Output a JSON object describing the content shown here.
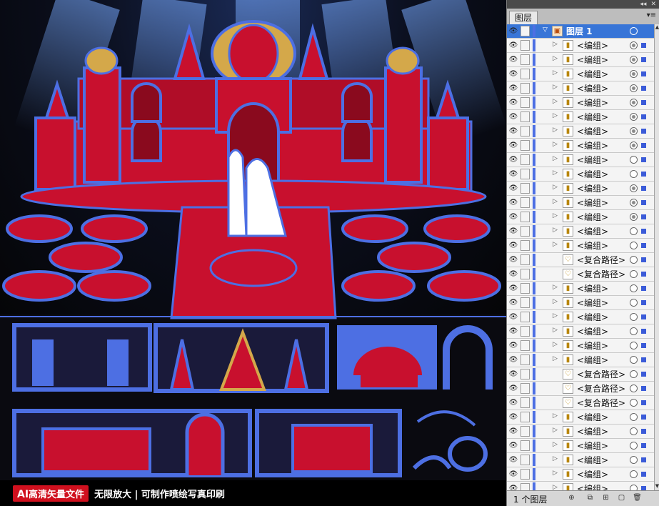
{
  "caption": {
    "badge_ai": "AI",
    "badge_text": "高清矢量文件",
    "tagline": "无限放大 | 可制作喷绘写真印刷"
  },
  "panel": {
    "tab_label": "图层",
    "footer_count": "1 个图层",
    "top_layer": "图层 1",
    "accent_color": "#3875d7",
    "layers": [
      {
        "name": "<编组>",
        "expand": true,
        "target": "double"
      },
      {
        "name": "<编组>",
        "expand": true,
        "target": "double"
      },
      {
        "name": "<编组>",
        "expand": true,
        "target": "double"
      },
      {
        "name": "<编组>",
        "expand": true,
        "target": "double"
      },
      {
        "name": "<编组>",
        "expand": true,
        "target": "double"
      },
      {
        "name": "<编组>",
        "expand": true,
        "target": "double"
      },
      {
        "name": "<编组>",
        "expand": true,
        "target": "double"
      },
      {
        "name": "<编组>",
        "expand": true,
        "target": "double"
      },
      {
        "name": "<编组>",
        "expand": true,
        "target": "single"
      },
      {
        "name": "<编组>",
        "expand": true,
        "target": "single"
      },
      {
        "name": "<编组>",
        "expand": true,
        "target": "double"
      },
      {
        "name": "<编组>",
        "expand": true,
        "target": "double"
      },
      {
        "name": "<编组>",
        "expand": true,
        "target": "double"
      },
      {
        "name": "<编组>",
        "expand": true,
        "target": "single"
      },
      {
        "name": "<编组>",
        "expand": true,
        "target": "single"
      },
      {
        "name": "<复合路径>",
        "expand": false,
        "target": "single"
      },
      {
        "name": "<复合路径>",
        "expand": false,
        "target": "single"
      },
      {
        "name": "<编组>",
        "expand": true,
        "target": "single"
      },
      {
        "name": "<编组>",
        "expand": true,
        "target": "single"
      },
      {
        "name": "<编组>",
        "expand": true,
        "target": "single"
      },
      {
        "name": "<编组>",
        "expand": true,
        "target": "single"
      },
      {
        "name": "<编组>",
        "expand": true,
        "target": "single"
      },
      {
        "name": "<编组>",
        "expand": true,
        "target": "single"
      },
      {
        "name": "<复合路径>",
        "expand": false,
        "target": "single"
      },
      {
        "name": "<复合路径>",
        "expand": false,
        "target": "single"
      },
      {
        "name": "<复合路径>",
        "expand": false,
        "target": "single"
      },
      {
        "name": "<编组>",
        "expand": true,
        "target": "single"
      },
      {
        "name": "<编组>",
        "expand": true,
        "target": "single"
      },
      {
        "name": "<编组>",
        "expand": true,
        "target": "single"
      },
      {
        "name": "<编组>",
        "expand": true,
        "target": "single"
      },
      {
        "name": "<编组>",
        "expand": true,
        "target": "single"
      },
      {
        "name": "<编组>",
        "expand": true,
        "target": "single"
      }
    ]
  },
  "colors": {
    "selection_blue": "#4d6fe3",
    "decor_red": "#c8102e",
    "gold": "#d4a84a"
  }
}
